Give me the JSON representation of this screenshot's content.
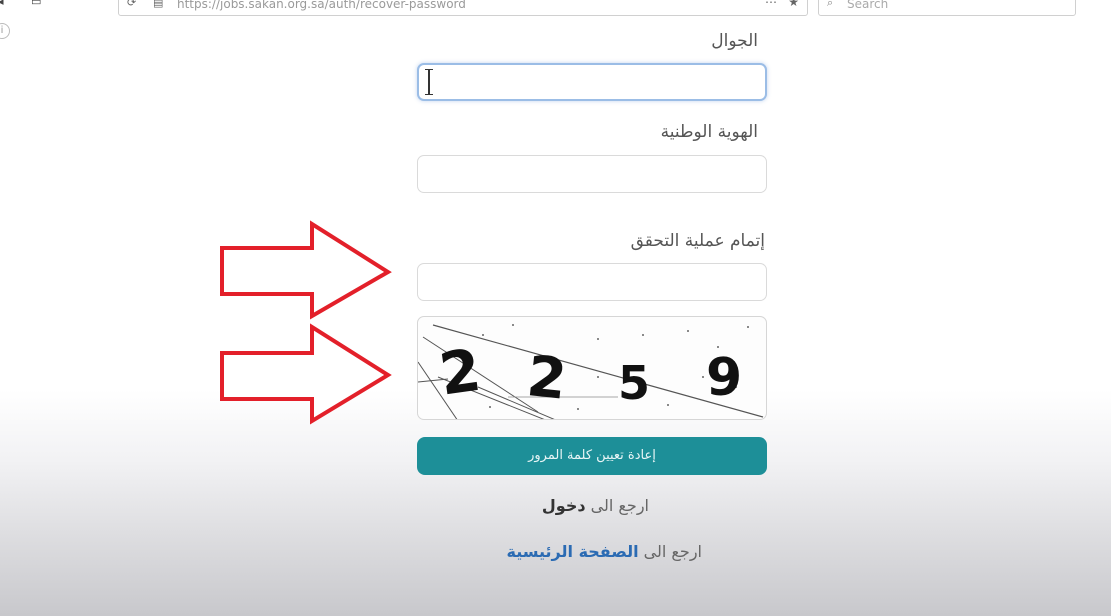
{
  "browser": {
    "url": "https://jobs.sakan.org.sa/auth/recover-password",
    "search_placeholder": "Search"
  },
  "form": {
    "mobile_label": "الجوال",
    "mobile_value": "",
    "national_id_label": "الهوية الوطنية",
    "national_id_value": "",
    "verify_label": "إتمام عملية التحقق",
    "verify_value": "",
    "captcha_code": [
      "2",
      "2",
      "5",
      "9"
    ],
    "submit_label": "إعادة تعيين كلمة المرور"
  },
  "links": {
    "login_prefix": "ارجع الى",
    "login_link": "دخول",
    "home_prefix": "ارجع الى",
    "home_link": "الصفحة الرئيسية"
  },
  "colors": {
    "submit_bg": "#1d8f98",
    "home_link": "#2b6bb3",
    "annotation_arrow": "#e3202a"
  },
  "icons": {
    "info": "info-icon",
    "search": "search-icon"
  }
}
